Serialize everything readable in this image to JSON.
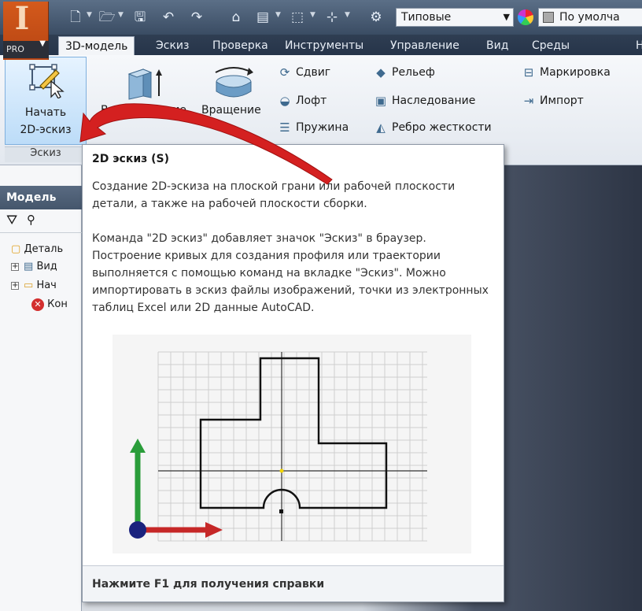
{
  "app": {
    "logo_letter": "I",
    "edition": "PRO"
  },
  "qat": {
    "combo_material": "Типовые",
    "combo_appearance": "По умолча"
  },
  "tabs": [
    {
      "label": "3D-модель",
      "active": true
    },
    {
      "label": "Эскиз"
    },
    {
      "label": "Проверка"
    },
    {
      "label": "Инструменты"
    },
    {
      "label": "Управление"
    },
    {
      "label": "Вид"
    },
    {
      "label": "Среды"
    },
    {
      "label": "Н"
    }
  ],
  "ribbon": {
    "start_sketch": {
      "line1": "Начать",
      "line2": "2D-эскиз"
    },
    "panel_label": "Эскиз",
    "extrude": "Выдавливание",
    "revolve": "Вращение",
    "sweep": "Сдвиг",
    "loft": "Лофт",
    "coil": "Пружина",
    "emboss": "Рельеф",
    "derive": "Наследование",
    "rib": "Ребро жесткости",
    "mark": "Маркировка",
    "import": "Импорт"
  },
  "browser": {
    "header": "Модель",
    "items": [
      {
        "label": "Деталь"
      },
      {
        "label": "Вид"
      },
      {
        "label": "Нач"
      },
      {
        "label": "Кон"
      }
    ]
  },
  "tooltip": {
    "title": "2D эскиз (S)",
    "para1": "Создание 2D-эскиза на плоской грани или рабочей плоскости детали, а также на рабочей плоскости сборки.",
    "para2": "Команда \"2D эскиз\" добавляет значок \"Эскиз\" в браузер. Построение кривых для создания профиля или траектории выполняется с помощью команд на вкладке \"Эскиз\". Можно импортировать в эскиз файлы изображений, точки из электронных таблиц Excel или 2D данные AutoCAD.",
    "footer": "Нажмите F1 для получения справки"
  },
  "colors": {
    "annotation_arrow": "#d42020",
    "axis_green": "#2a9d3a",
    "axis_red": "#c62828",
    "origin_blue": "#1a237e"
  }
}
